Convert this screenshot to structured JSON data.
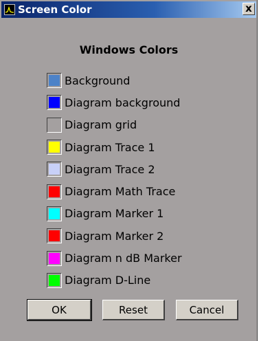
{
  "window": {
    "title": "Screen Color",
    "close_label": "x"
  },
  "heading": "Windows Colors",
  "colors": [
    {
      "label": "Background",
      "color": "#4c82c8"
    },
    {
      "label": "Diagram background",
      "color": "#0000ff"
    },
    {
      "label": "Diagram grid",
      "color": "#a4a0a0"
    },
    {
      "label": "Diagram Trace 1",
      "color": "#ffff00"
    },
    {
      "label": "Diagram Trace 2",
      "color": "#c8d0f8"
    },
    {
      "label": "Diagram Math Trace",
      "color": "#ff0000"
    },
    {
      "label": "Diagram Marker 1",
      "color": "#00ffff"
    },
    {
      "label": "Diagram Marker 2",
      "color": "#ff0000"
    },
    {
      "label": "Diagram n dB Marker",
      "color": "#ff00ff"
    },
    {
      "label": "Diagram D-Line",
      "color": "#00ff00"
    }
  ],
  "buttons": {
    "ok": "OK",
    "reset": "Reset",
    "cancel": "Cancel"
  }
}
